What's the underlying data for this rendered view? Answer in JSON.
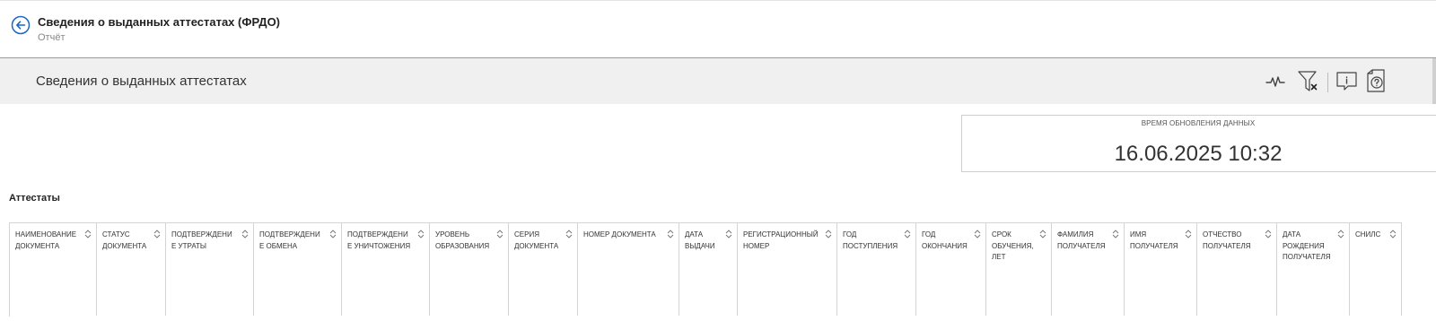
{
  "header": {
    "title": "Сведения о выданных аттестатах (ФРДО)",
    "subtitle": "Отчёт"
  },
  "report": {
    "title": "Сведения о выданных аттестатах",
    "toolbar": [
      {
        "name": "pulse-icon"
      },
      {
        "name": "clear-filter-icon"
      },
      {
        "name": "info-icon"
      },
      {
        "name": "help-icon"
      }
    ]
  },
  "update": {
    "label": "ВРЕМЯ ОБНОВЛЕНИЯ ДАННЫХ",
    "value": "16.06.2025 10:32"
  },
  "table": {
    "title": "Аттестаты",
    "columns": [
      "НАИМЕНОВАНИЕ ДОКУМЕНТА",
      "СТАТУС ДОКУМЕНТА",
      "ПОДТВЕРЖДЕНИЕ УТРАТЫ",
      "ПОДТВЕРЖДЕНИЕ ОБМЕНА",
      "ПОДТВЕРЖДЕНИЕ УНИЧТОЖЕНИЯ",
      "УРОВЕНЬ ОБРАЗОВАНИЯ",
      "СЕРИЯ ДОКУМЕНТА",
      "НОМЕР ДОКУМЕНТА",
      "ДАТА ВЫДАЧИ",
      "РЕГИСТРАЦИОННЫЙ НОМЕР",
      "ГОД ПОСТУПЛЕНИЯ",
      "ГОД ОКОНЧАНИЯ",
      "СРОК ОБУЧЕНИЯ, ЛЕТ",
      "ФАМИЛИЯ ПОЛУЧАТЕЛЯ",
      "ИМЯ ПОЛУЧАТЕЛЯ",
      "ОТЧЕСТВО ПОЛУЧАТЕЛЯ",
      "ДАТА РОЖДЕНИЯ ПОЛУЧАТЕЛЯ",
      "СНИЛС"
    ]
  },
  "colors": {
    "accent": "#1a66c6",
    "report_bar": "#f0f0f0",
    "border": "#d4d4d4"
  }
}
